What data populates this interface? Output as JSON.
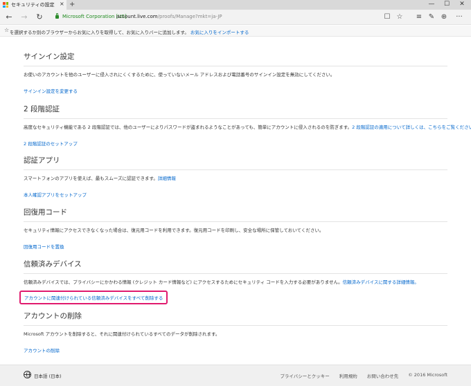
{
  "browser": {
    "tab_title": "セキュリティの設定",
    "tab_close": "×",
    "new_tab": "+",
    "win_min": "—",
    "win_max": "☐",
    "win_close": "✕",
    "back": "←",
    "forward": "→",
    "refresh": "↻",
    "cert_owner": "Microsoft Corporation [US]",
    "url_host": "account.live.com",
    "url_path": "/proofs/Manage?mkt=ja-JP",
    "reading_view": "☐",
    "favorite_star": "☆",
    "hub": "≡",
    "notes": "✎",
    "share": "⊕",
    "more": "···"
  },
  "favbar": {
    "star": "☆",
    "message": "を選択するか別のブラウザーからお気に入りを取得して、お気に入りバーに追加します。",
    "import_link": "お気に入りをインポートする"
  },
  "sections": [
    {
      "title": "サインイン設定",
      "desc": "お使いのアカウントを他のユーザーに侵入されにくくするために、使っていないメール アドレスおよび電話番号のサインイン設定を無効にしてください。",
      "link": "サインイン設定を変更する"
    },
    {
      "title": "2 段階認証",
      "desc": "高度なセキュリティ機能である 2 段階認証では、他のユーザーによりパスワードが盗まれるようなことがあっても、簡単にアカウントに侵入されるのを防ぎます。",
      "desc_link": "2 段階認証の適用について詳しくは、こちらをご覧ください。",
      "link": "2 段階認証のセットアップ"
    },
    {
      "title": "認証アプリ",
      "desc": "スマートフォンのアプリを使えば、最もスムーズに認証できます。",
      "desc_link": "詳細情報",
      "link": "本人確認アプリをセットアップ"
    },
    {
      "title": "回復用コード",
      "desc": "セキュリティ情報にアクセスできなくなった場合は、復元用コードを利用できます。復元用コードを印刷し、安全な場所に保管しておいてください。",
      "link": "回復用コードを置換"
    },
    {
      "title": "信頼済みデバイス",
      "desc": "信頼済みデバイスでは、プライバシーにかかわる情報 (クレジット カード情報など) にアクセスするためにセキュリティ コードを入力する必要がありません。",
      "desc_link": "信頼済みデバイスに関する詳細情報。",
      "link": "アカウントに関連付けられている信頼済みデバイスをすべて削除する"
    },
    {
      "title": "アカウントの削除",
      "desc": "Microsoft アカウントを削除すると、それに関連付けられているすべてのデータが削除されます。",
      "link": "アカウントの削除"
    }
  ],
  "footer": {
    "language": "日本語 (日本)",
    "links": [
      "プライバシーとクッキー",
      "利用規約",
      "お問い合わせ先",
      "© 2016 Microsoft"
    ]
  },
  "colors": {
    "link": "#0066cc",
    "highlight_border": "#e01a6e",
    "secure_green": "#1e8a1e"
  }
}
